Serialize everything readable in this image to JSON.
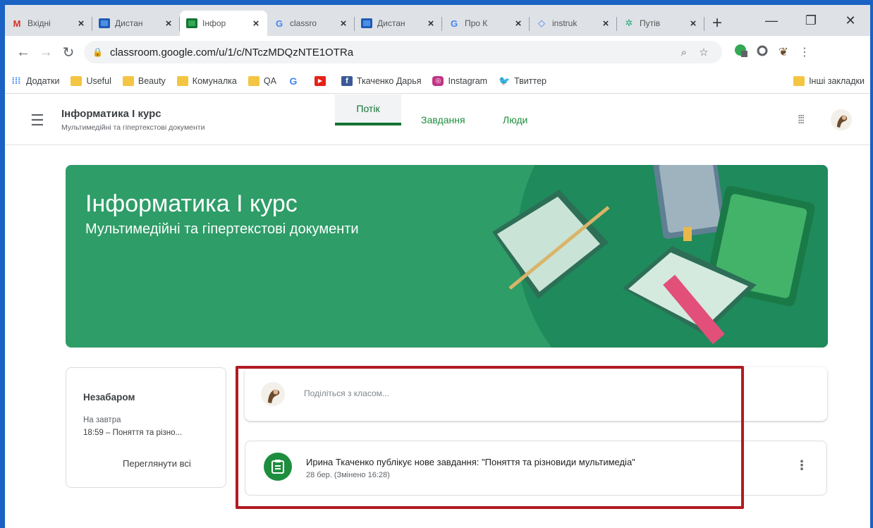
{
  "browser": {
    "tabs": [
      {
        "icon": "gmail-icon",
        "title": "Вхідні",
        "active": false
      },
      {
        "icon": "classroom-icon",
        "title": "Дистан",
        "active": false
      },
      {
        "icon": "classroom-icon",
        "title": "Інфор",
        "active": true
      },
      {
        "icon": "google-icon",
        "title": "classro",
        "active": false
      },
      {
        "icon": "classroom-icon",
        "title": "Дистан",
        "active": false
      },
      {
        "icon": "google-icon",
        "title": "Про К",
        "active": false
      },
      {
        "icon": "diamond-icon",
        "title": "instruk",
        "active": false
      },
      {
        "icon": "guide-icon",
        "title": "Путів",
        "active": false
      }
    ],
    "close_glyph": "×",
    "url": "classroom.google.com/u/1/c/NTczMDQzNTE1OTRa",
    "bookmarks": [
      {
        "icon": "apps-icon",
        "label": "Додатки"
      },
      {
        "icon": "folder-icon",
        "label": "Useful"
      },
      {
        "icon": "folder-icon",
        "label": "Beauty"
      },
      {
        "icon": "folder-icon",
        "label": "Комуналка"
      },
      {
        "icon": "folder-icon",
        "label": "QA"
      },
      {
        "icon": "google-icon",
        "label": ""
      },
      {
        "icon": "youtube-icon",
        "label": ""
      },
      {
        "icon": "facebook-icon",
        "label": "Ткаченко Дарья"
      },
      {
        "icon": "instagram-icon",
        "label": "Instagram"
      },
      {
        "icon": "twitter-icon",
        "label": "Твиттер"
      }
    ],
    "other_bookmarks": "Інші закладки"
  },
  "classroom": {
    "course_title": "Інформатика І курс",
    "course_section": "Мультимедійні та гіпертекстові документи",
    "tabs": {
      "stream": "Потік",
      "classwork": "Завдання",
      "people": "Люди"
    },
    "banner": {
      "title": "Інформатика І курс",
      "subtitle": "Мультимедійні та гіпертекстові документи"
    },
    "upcoming": {
      "title": "Незабаром",
      "when": "На завтра",
      "item": "18:59 – Поняття та різно...",
      "view_all": "Переглянути всі"
    },
    "share_placeholder": "Поділіться з класом...",
    "post": {
      "text": "Ирина Ткаченко публікує нове завдання: \"Поняття та різновиди мультимедіа\"",
      "date": "28 бер. (Змінено 16:28)"
    }
  },
  "colors": {
    "accent_green": "#1e8e3e",
    "banner_green": "#2e9d68",
    "highlight_red": "#b11b24",
    "frame_blue": "#1a62c4"
  }
}
